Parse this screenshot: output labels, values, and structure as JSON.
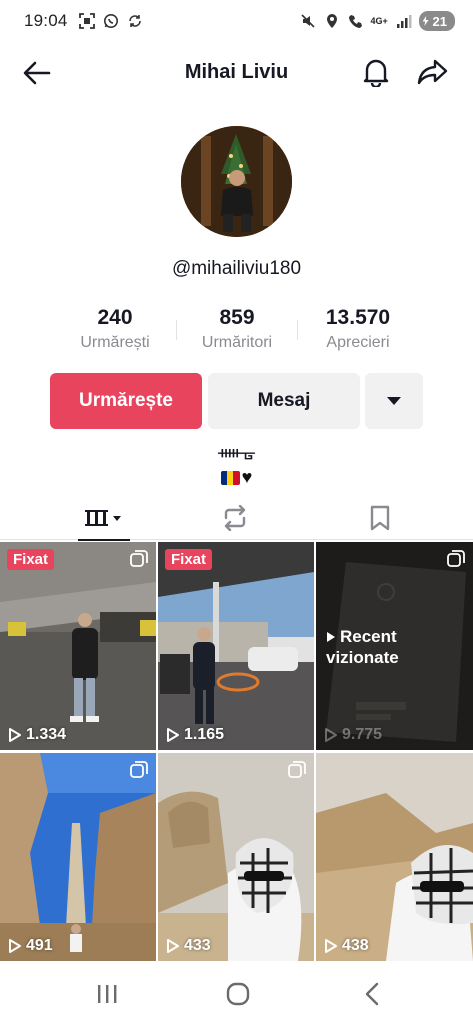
{
  "status_bar": {
    "time": "19:04",
    "battery": "21",
    "network": "4G+"
  },
  "header": {
    "title": "Mihai Liviu"
  },
  "profile": {
    "username": "@mihailiviu180",
    "stats": [
      {
        "value": "240",
        "label": "Urmărești"
      },
      {
        "value": "859",
        "label": "Urmăritori"
      },
      {
        "value": "13.570",
        "label": "Aprecieri"
      }
    ],
    "bio_line1": "ᚔᚗ",
    "follow_label": "Urmărește",
    "message_label": "Mesaj"
  },
  "colors": {
    "accent": "#e9445e",
    "button_gray": "#f1f1f2",
    "text": "#161823",
    "muted": "#8a8b91"
  },
  "videos": [
    {
      "pinned_label": "Fixat",
      "views": "1.334",
      "multi": true
    },
    {
      "pinned_label": "Fixat",
      "views": "1.165",
      "multi": false
    },
    {
      "views": "9.775",
      "recent_label_1": "Recent",
      "recent_label_2": "vizionate",
      "multi": true
    },
    {
      "views": "491",
      "multi": true
    },
    {
      "views": "433",
      "multi": true
    },
    {
      "views": "438",
      "multi": false
    }
  ]
}
